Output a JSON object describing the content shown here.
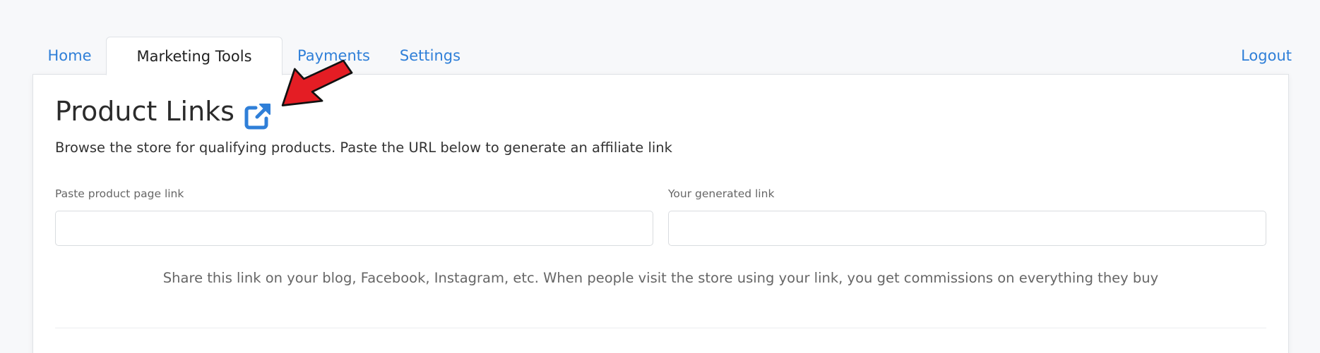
{
  "nav": {
    "tabs": [
      {
        "label": "Home"
      },
      {
        "label": "Marketing Tools"
      },
      {
        "label": "Payments"
      },
      {
        "label": "Settings"
      }
    ],
    "active_tab": "Marketing Tools",
    "logout_label": "Logout"
  },
  "main": {
    "title": "Product Links",
    "title_icon": "external-link-icon",
    "subtitle": "Browse the store for qualifying products. Paste the URL below to generate an affiliate link",
    "product_link": {
      "label": "Paste product page link",
      "value": "",
      "placeholder": ""
    },
    "generated_link": {
      "label": "Your generated link",
      "value": "",
      "placeholder": ""
    },
    "share_text": "Share this link on your blog, Facebook, Instagram, etc. When people visit the store using your link, you get commissions on everything they buy"
  },
  "colors": {
    "accent": "#2f7fd8",
    "annotation_arrow": "#e41d24",
    "background": "#f7f8fa",
    "card": "#ffffff"
  }
}
